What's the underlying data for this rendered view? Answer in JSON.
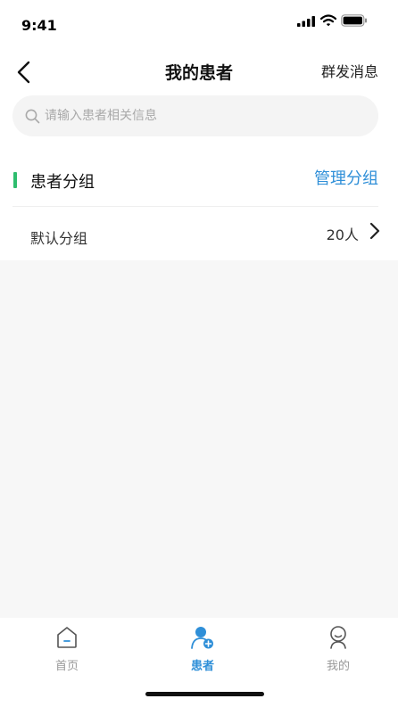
{
  "status_bar": {
    "time": "9:41"
  },
  "nav": {
    "title": "我的患者",
    "right_action": "群发消息"
  },
  "search": {
    "placeholder": "请输入患者相关信息",
    "value": ""
  },
  "section": {
    "title": "患者分组",
    "action": "管理分组"
  },
  "groups": [
    {
      "name": "默认分组",
      "count": "20人"
    }
  ],
  "tabs": [
    {
      "label": "首页",
      "icon": "home-icon",
      "active": false
    },
    {
      "label": "患者",
      "icon": "patient-icon",
      "active": true
    },
    {
      "label": "我的",
      "icon": "user-icon",
      "active": false
    }
  ],
  "colors": {
    "accent": "#2f8fd8",
    "section_bar": "#2ebd6e",
    "background": "#f7f7f7",
    "inactive_tab": "#999999"
  }
}
